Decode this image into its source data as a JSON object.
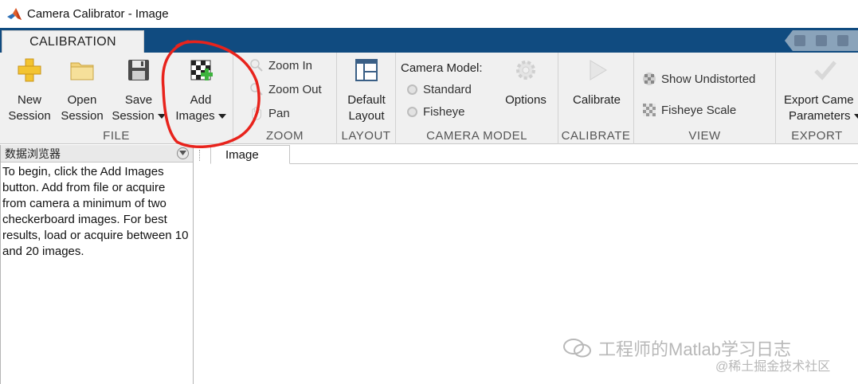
{
  "window": {
    "title": "Camera Calibrator - Image"
  },
  "tabs": {
    "active": "CALIBRATION"
  },
  "ribbon": {
    "file": {
      "label": "FILE",
      "new_session": {
        "line1": "New",
        "line2": "Session"
      },
      "open_session": {
        "line1": "Open",
        "line2": "Session"
      },
      "save_session": {
        "line1": "Save",
        "line2": "Session"
      },
      "add_images": {
        "line1": "Add",
        "line2": "Images"
      }
    },
    "zoom": {
      "label": "ZOOM",
      "zoom_in": "Zoom In",
      "zoom_out": "Zoom Out",
      "pan": "Pan"
    },
    "layout": {
      "label": "LAYOUT",
      "default_layout": {
        "line1": "Default",
        "line2": "Layout"
      }
    },
    "camera_model": {
      "label": "CAMERA MODEL",
      "heading": "Camera Model:",
      "standard": "Standard",
      "fisheye": "Fisheye",
      "options": "Options"
    },
    "calibrate": {
      "label": "CALIBRATE",
      "calibrate": "Calibrate"
    },
    "view": {
      "label": "VIEW",
      "show_undistorted": "Show Undistorted",
      "fisheye_scale": "Fisheye Scale"
    },
    "export": {
      "label": "EXPORT",
      "line1": "Export Came",
      "line2": "Parameters"
    }
  },
  "browser": {
    "title": "数据浏览器",
    "instructions": "To begin, click the Add Images button. Add from file or acquire from camera a minimum of two checkerboard images. For best results, load or acquire between 10 and 20 images."
  },
  "document": {
    "tab": "Image"
  },
  "watermark": {
    "line1": "工程师的Matlab学习日志",
    "line2": "@稀土掘金技术社区"
  },
  "colors": {
    "tabstrip": "#104b80",
    "ribbon": "#f0f0f0",
    "annotation": "#e8231c"
  }
}
